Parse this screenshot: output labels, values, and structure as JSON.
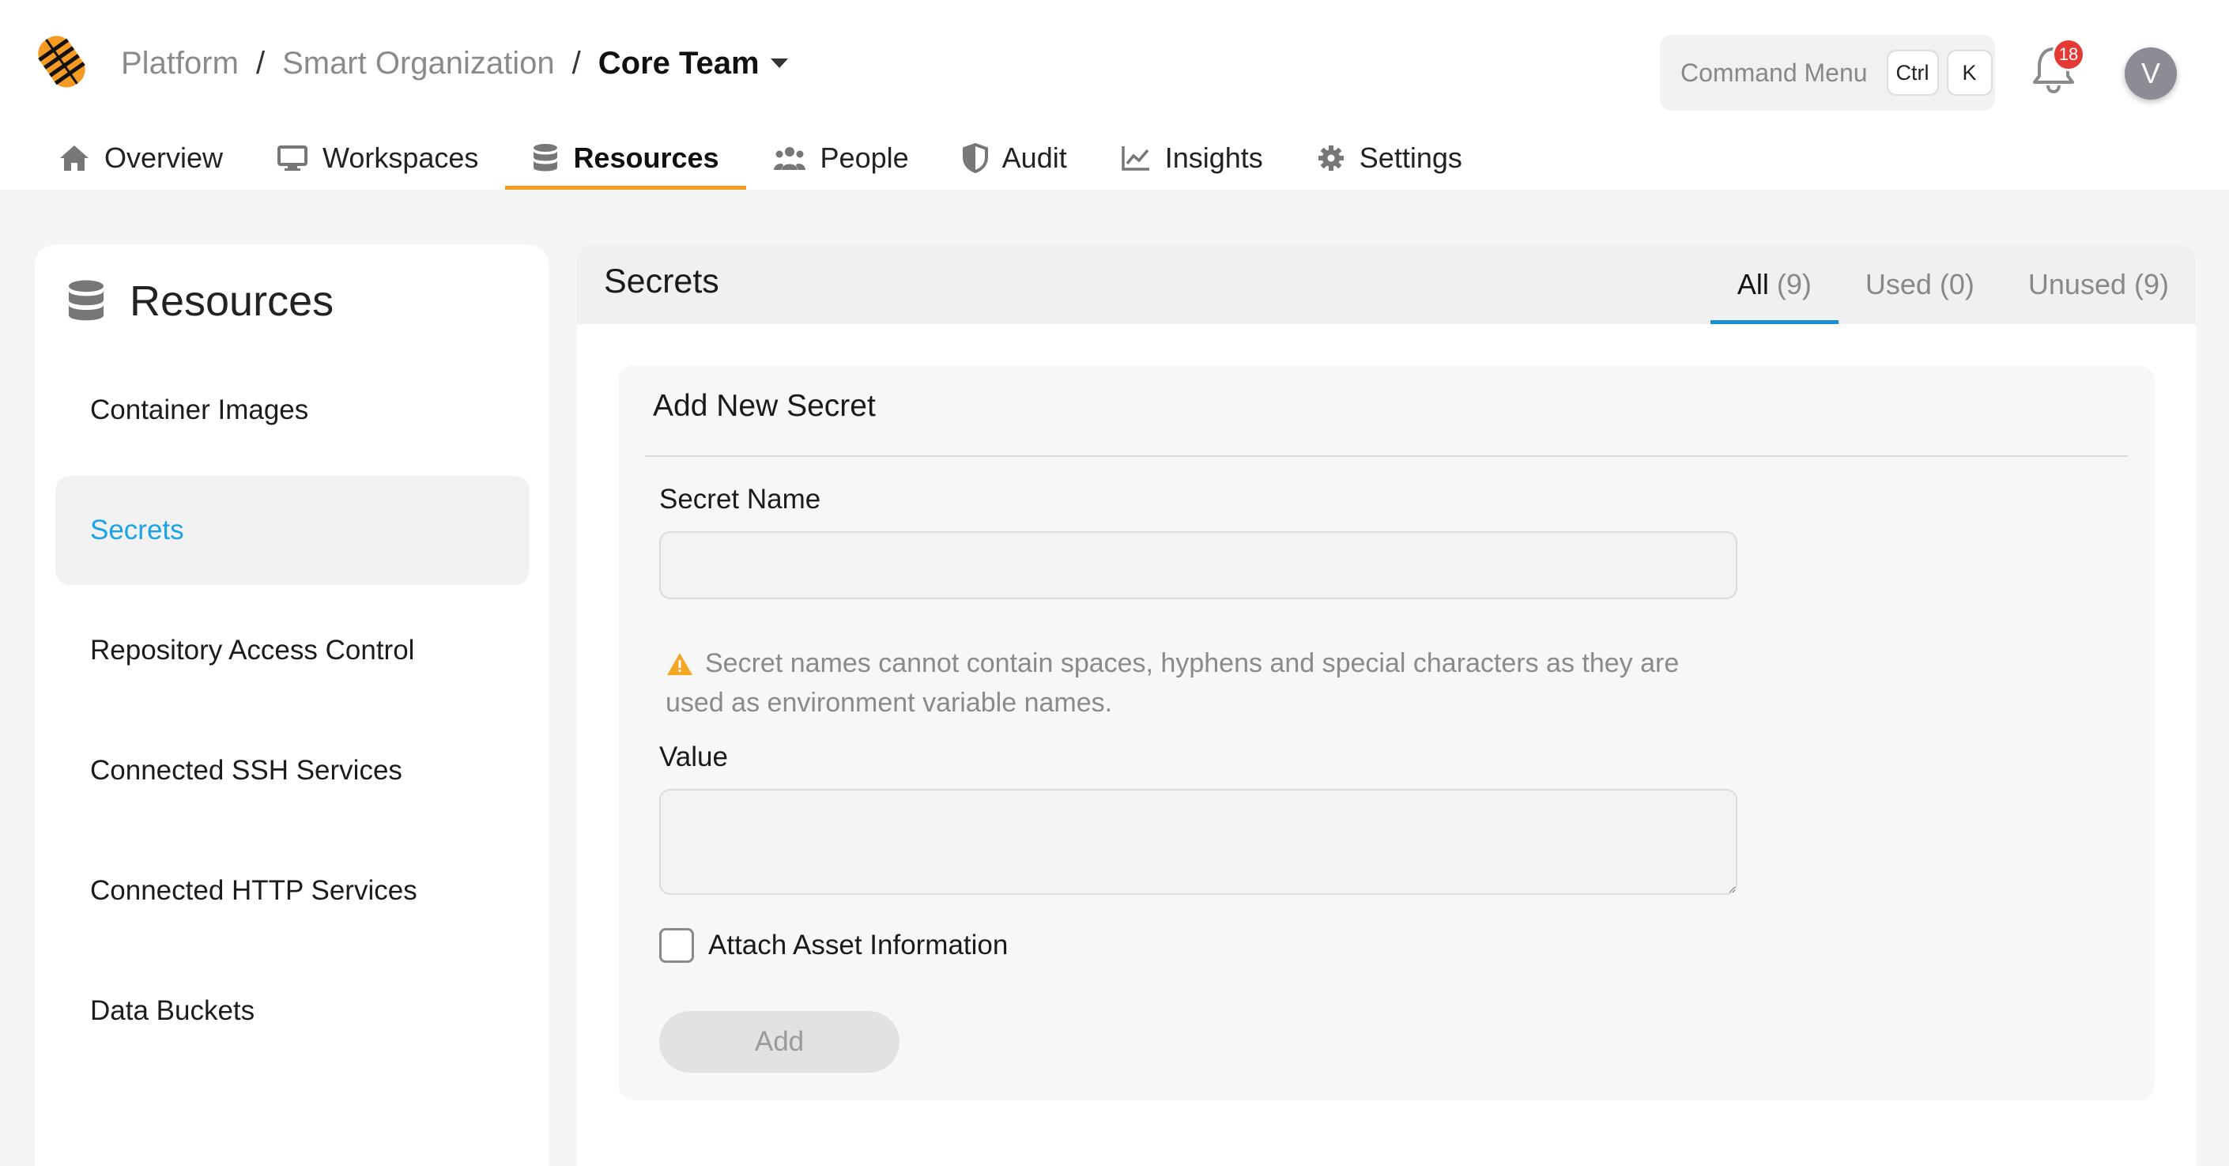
{
  "header": {
    "breadcrumb": [
      "Platform",
      "Smart Organization"
    ],
    "current_team": "Core Team",
    "command_menu": {
      "label": "Command Menu",
      "keys": [
        "Ctrl",
        "K"
      ]
    },
    "notification_count": "18",
    "avatar_initial": "V"
  },
  "nav": {
    "tabs": [
      {
        "label": "Overview",
        "icon": "home-icon"
      },
      {
        "label": "Workspaces",
        "icon": "monitor-icon"
      },
      {
        "label": "Resources",
        "icon": "database-icon",
        "active": true
      },
      {
        "label": "People",
        "icon": "people-icon"
      },
      {
        "label": "Audit",
        "icon": "shield-icon"
      },
      {
        "label": "Insights",
        "icon": "chart-line-icon"
      },
      {
        "label": "Settings",
        "icon": "gear-icon"
      }
    ]
  },
  "sidebar": {
    "title": "Resources",
    "items": [
      {
        "label": "Container Images"
      },
      {
        "label": "Secrets",
        "active": true
      },
      {
        "label": "Repository Access Control"
      },
      {
        "label": "Connected SSH Services"
      },
      {
        "label": "Connected HTTP Services"
      },
      {
        "label": "Data Buckets"
      }
    ]
  },
  "main": {
    "title": "Secrets",
    "filters": [
      {
        "label": "All",
        "count": "(9)",
        "active": true
      },
      {
        "label": "Used",
        "count": "(0)"
      },
      {
        "label": "Unused",
        "count": "(9)"
      }
    ],
    "form": {
      "title": "Add New Secret",
      "name_label": "Secret Name",
      "name_value": "",
      "hint_line1": "Secret names cannot contain spaces, hyphens and special characters as they are",
      "hint_line2": "used as environment variable names.",
      "value_label": "Value",
      "value_value": "",
      "checkbox_label": "Attach Asset Information",
      "submit_label": "Add"
    }
  },
  "colors": {
    "accent_orange": "#f59a23",
    "active_link": "#1aa3e6",
    "tab_underline": "#1a8fd6",
    "badge_red": "#e53935",
    "warning_amber": "#f5a623"
  }
}
